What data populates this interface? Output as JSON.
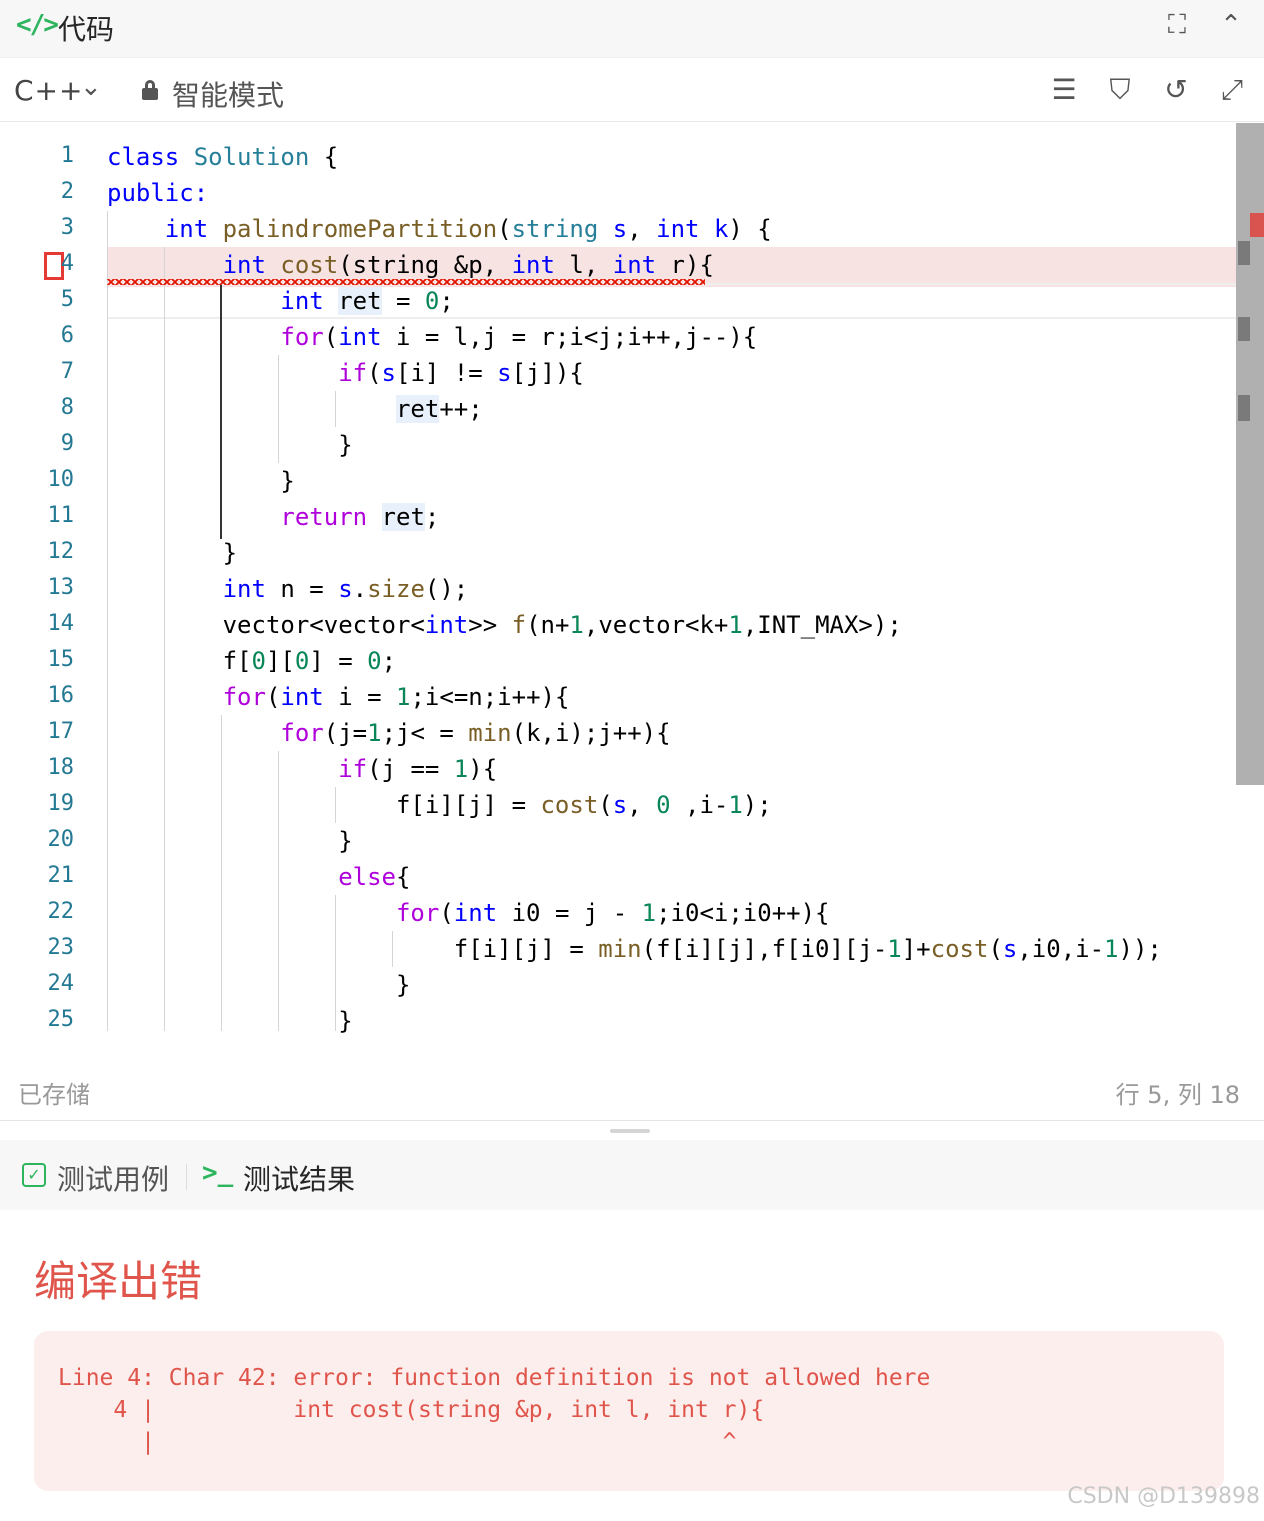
{
  "header": {
    "logo": "</>",
    "title": "代码"
  },
  "toolbar": {
    "language": "C++",
    "mode": "智能模式"
  },
  "editor": {
    "line_numbers": [
      "1",
      "2",
      "3",
      "4",
      "5",
      "6",
      "7",
      "8",
      "9",
      "10",
      "11",
      "12",
      "13",
      "14",
      "15",
      "16",
      "17",
      "18",
      "19",
      "20",
      "21",
      "22",
      "23",
      "24",
      "25"
    ]
  },
  "status": {
    "saved": "已存储",
    "cursor": "行 5, 列 18"
  },
  "panel": {
    "tab_testcase": "测试用例",
    "tab_result": "测试结果",
    "result_title": "编译出错"
  },
  "error": {
    "line1": "Line 4: Char 42: error: function definition is not allowed here",
    "line2": "    4 |          int cost(string &p, int l, int r){",
    "line3": "      |                                         ^"
  },
  "watermark": "CSDN @D139898"
}
